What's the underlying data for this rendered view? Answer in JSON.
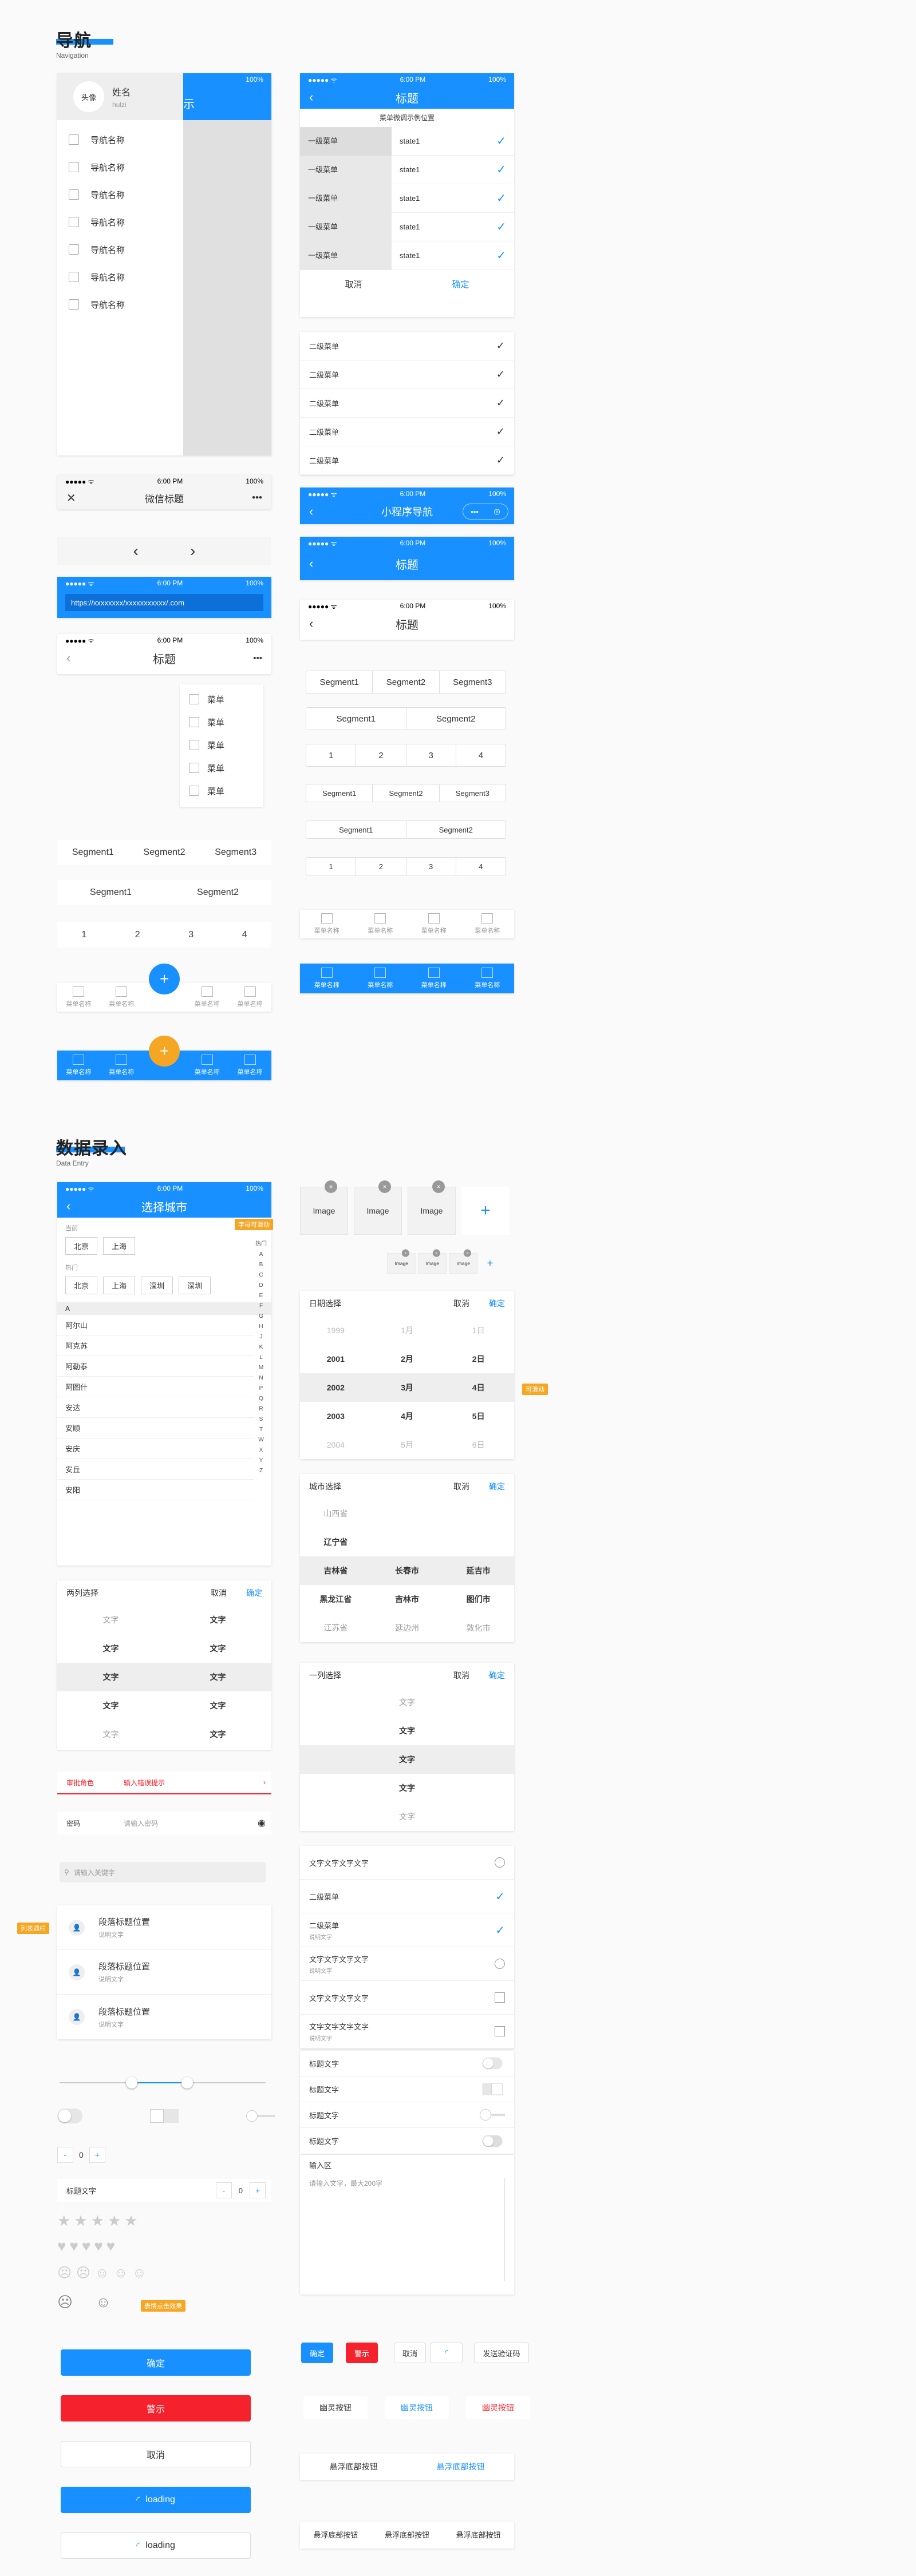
{
  "nav_section": {
    "title": "导航",
    "subtitle": "Navigation"
  },
  "data_section": {
    "title": "数据录入",
    "subtitle": "Data Entry"
  },
  "status": {
    "time": "6:00 PM",
    "battery": "100%",
    "signal": "●●●●● ᯤ"
  },
  "drawer": {
    "avatar": "头像",
    "name": "姓名",
    "sub": "hulzi",
    "items": [
      "导航名称",
      "导航名称",
      "导航名称",
      "导航名称",
      "导航名称",
      "导航名称",
      "导航名称"
    ],
    "peek": "示"
  },
  "wechat": {
    "title": "微信标题",
    "close": "✕",
    "more": "•••"
  },
  "pager": {
    "prev": "‹",
    "next": "›"
  },
  "url_bar": {
    "url": "https://xxxxxxxx/xxxxxxxxxxx/.com"
  },
  "menu_page": {
    "title": "标题",
    "menu_items": [
      "菜单",
      "菜单",
      "菜单",
      "菜单",
      "菜单"
    ]
  },
  "segments_left": {
    "three": [
      "Segment1",
      "Segment2",
      "Segment3"
    ],
    "two": [
      "Segment1",
      "Segment2"
    ],
    "nums": [
      "1",
      "2",
      "3",
      "4"
    ]
  },
  "tabbar": {
    "label": "菜单名称",
    "fab": "+"
  },
  "filter_page": {
    "title": "标题",
    "hint": "菜单微调示例位置",
    "level1": [
      "一级菜单",
      "一级菜单",
      "一级菜单",
      "一级菜单",
      "一级菜单"
    ],
    "state": "state1",
    "cancel": "取消",
    "confirm": "确定",
    "level2": [
      "二级菜单",
      "二级菜单",
      "二级菜单",
      "二级菜单",
      "二级菜单"
    ]
  },
  "mini_nav": {
    "title": "小程序导航",
    "dots": "•••"
  },
  "right_title": {
    "title": "标题"
  },
  "city": {
    "title": "选择城市",
    "tag": "字母可滑动",
    "current_label": "当前",
    "current": [
      "北京",
      "上海"
    ],
    "hot_label": "热门",
    "hot": [
      "北京",
      "上海",
      "深圳",
      "深圳"
    ],
    "index_label": "热门",
    "letters": [
      "A",
      "B",
      "C",
      "D",
      "E",
      "F",
      "G",
      "H",
      "J",
      "K",
      "L",
      "M",
      "N",
      "P",
      "Q",
      "R",
      "S",
      "T",
      "W",
      "X",
      "Y",
      "Z"
    ],
    "group": "A",
    "names": [
      "阿尔山",
      "阿克苏",
      "阿勒泰",
      "阿图什",
      "安达",
      "安顺",
      "安庆",
      "安丘",
      "安阳"
    ]
  },
  "two_col": {
    "title": "两列选择",
    "cancel": "取消",
    "confirm": "确定",
    "left": [
      "文字",
      "文字",
      "文字",
      "文字",
      "文字"
    ],
    "right": [
      "文字",
      "文字",
      "文字",
      "文字",
      "文字"
    ]
  },
  "form": {
    "role_label": "审批角色",
    "role_value": "输入错误提示",
    "pwd_label": "密码",
    "pwd_placeholder": "请输入密码",
    "search_placeholder": "请输入关键字",
    "list_tag": "列表通栏",
    "list_title": "段落标题位置",
    "list_sub": "说明文字"
  },
  "slider": {
    "low": 0.35,
    "high": 0.62
  },
  "stepper": {
    "value": "0",
    "minus": "-",
    "plus": "+",
    "label": "标题文字"
  },
  "rating_tag": "表情点击效果",
  "buttons_left": {
    "confirm": "确定",
    "warn": "警示",
    "cancel": "取消",
    "loading": "loading"
  },
  "images": {
    "label": "Image",
    "add": "+",
    "close": "×"
  },
  "date_picker": {
    "title": "日期选择",
    "cancel": "取消",
    "confirm": "确定",
    "tag": "可滑动",
    "years": [
      "1999",
      "2001",
      "2002",
      "2003",
      "2004"
    ],
    "months": [
      "1月",
      "2月",
      "3月",
      "4月",
      "5月"
    ],
    "days": [
      "1日",
      "2日",
      "4日",
      "5日",
      "6日"
    ]
  },
  "city_picker": {
    "title": "城市选择",
    "cancel": "取消",
    "confirm": "确定",
    "rows": [
      [
        "山西省",
        "",
        ""
      ],
      [
        "辽宁省",
        "",
        ""
      ],
      [
        "吉林省",
        "长春市",
        "延吉市"
      ],
      [
        "黑龙江省",
        "吉林市",
        "图们市"
      ],
      [
        "江苏省",
        "延边州",
        "敦化市"
      ]
    ]
  },
  "single_picker": {
    "title": "一列选择",
    "cancel": "取消",
    "confirm": "确定",
    "rows": [
      "文字",
      "文字",
      "文字",
      "文字",
      "文字"
    ]
  },
  "checklist": {
    "rows": [
      {
        "text": "文字文字文字文字",
        "sub": "",
        "mark": "radio"
      },
      {
        "text": "二级菜单",
        "sub": "",
        "mark": "check"
      },
      {
        "text": "二级菜单",
        "sub": "说明文字",
        "mark": "check"
      },
      {
        "text": "文字文字文字文字",
        "sub": "说明文字",
        "mark": "radio"
      },
      {
        "text": "文字文字文字文字",
        "sub": "",
        "mark": "square"
      },
      {
        "text": "文字文字文字文字",
        "sub": "说明文字",
        "mark": "square"
      }
    ]
  },
  "switches": {
    "label": "标题文字"
  },
  "textarea": {
    "label": "输入区",
    "placeholder": "请输入文字，最大200字"
  },
  "small_buttons": {
    "confirm": "确定",
    "warn": "警示",
    "cancel": "取消",
    "code": "发送验证码",
    "ghost": "幽灵按钮",
    "float": "悬浮底部按钮"
  }
}
